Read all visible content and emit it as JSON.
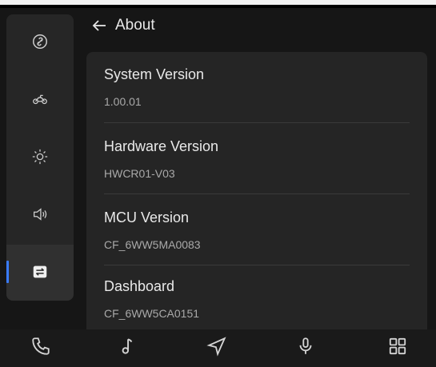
{
  "header": {
    "title": "About"
  },
  "sidebar": {
    "items": [
      {
        "icon": "link-icon",
        "active": false
      },
      {
        "icon": "car-icon",
        "active": false
      },
      {
        "icon": "brightness-icon",
        "active": false
      },
      {
        "icon": "volume-icon",
        "active": false
      },
      {
        "icon": "swap-icon",
        "active": true
      }
    ],
    "accent_color": "#3a7cff"
  },
  "about": {
    "rows": [
      {
        "title": "System Version",
        "value": "1.00.01"
      },
      {
        "title": "Hardware Version",
        "value": "HWCR01-V03"
      },
      {
        "title": "MCU Version",
        "value": "CF_6WW5MA0083"
      },
      {
        "title": "Dashboard",
        "value": "CF_6WW5CA0151"
      }
    ]
  },
  "bottom_nav": {
    "items": [
      {
        "icon": "phone-icon"
      },
      {
        "icon": "music-note-icon"
      },
      {
        "icon": "navigation-icon"
      },
      {
        "icon": "microphone-icon"
      },
      {
        "icon": "apps-grid-icon"
      }
    ]
  }
}
